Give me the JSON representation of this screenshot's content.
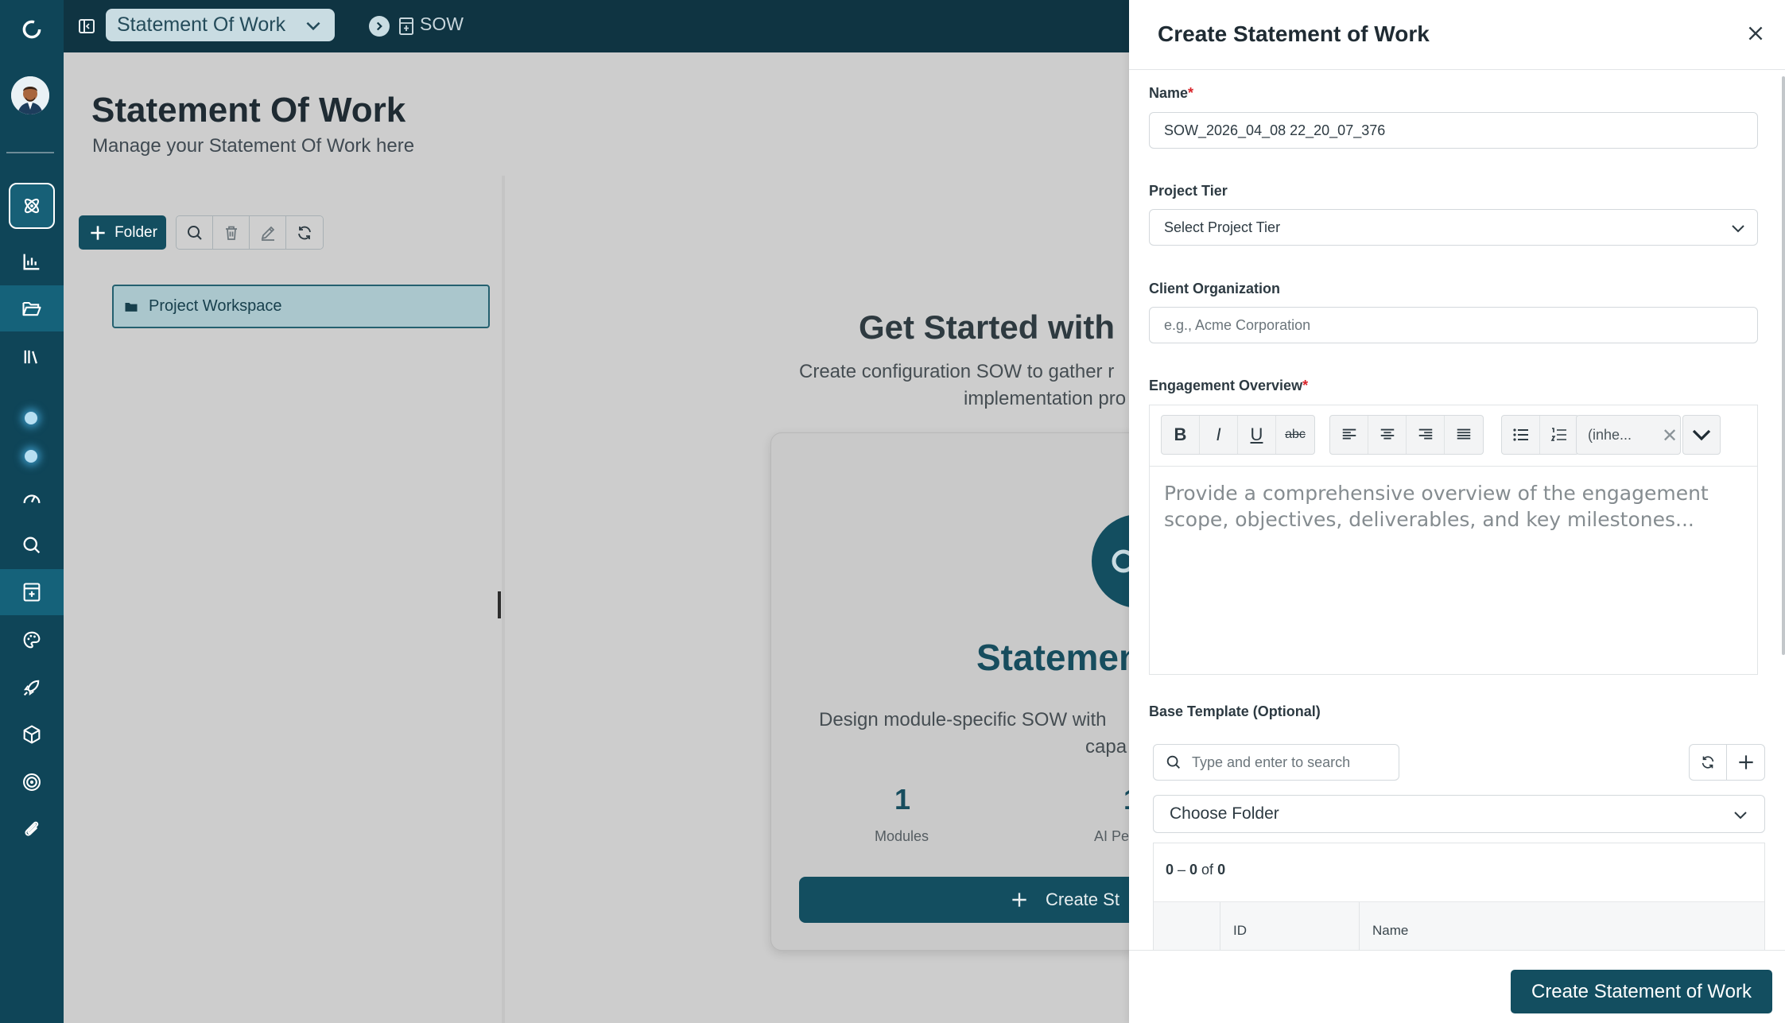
{
  "app": {
    "workspace_selector": "Statement Of Work",
    "breadcrumb_label": "SOW"
  },
  "sidebar": {
    "items": [
      {
        "icon": "logo-icon"
      },
      {
        "icon": "avatar"
      },
      {
        "icon": "atom-icon"
      },
      {
        "icon": "bar-chart-icon"
      },
      {
        "icon": "folder-open-icon"
      },
      {
        "icon": "library-icon"
      },
      {
        "icon": "status-dot"
      },
      {
        "icon": "status-dot"
      },
      {
        "icon": "gauge-icon"
      },
      {
        "icon": "search-icon"
      },
      {
        "icon": "calculator-doc-icon"
      },
      {
        "icon": "palette-icon"
      },
      {
        "icon": "rocket-icon"
      },
      {
        "icon": "cube-icon"
      },
      {
        "icon": "target-icon"
      },
      {
        "icon": "paperclip-icon"
      }
    ]
  },
  "page": {
    "title": "Statement Of Work",
    "subtitle": "Manage your Statement Of Work here",
    "folder_button": "Folder",
    "tree_item": "Project Workspace"
  },
  "empty_state": {
    "title": "Get Started with",
    "sub_line1": "Create configuration SOW to gather r",
    "sub_line2": "implementation pro",
    "card_title": "Statemen",
    "card_desc1": "Design module-specific SOW with",
    "card_desc2": "capa",
    "stat1_value": "1",
    "stat1_label": "Modules",
    "stat2_value": "1",
    "stat2_label": "AI Pe",
    "cta": "Create St"
  },
  "panel": {
    "title": "Create Statement of Work",
    "name_label": "Name",
    "name_value": "SOW_2026_04_08 22_20_07_376",
    "tier_label": "Project Tier",
    "tier_placeholder": "Select Project Tier",
    "client_label": "Client Organization",
    "client_placeholder": "e.g., Acme Corporation",
    "overview_label": "Engagement Overview",
    "overview_placeholder": "Provide a comprehensive overview of the engagement scope, objectives, deliverables, and key milestones...",
    "toolbar": {
      "bold": "B",
      "italic": "I",
      "underline": "U",
      "strike": "abc",
      "font_select": "(inhe..."
    },
    "template_label": "Base Template (Optional)",
    "search_placeholder": "Type and enter to search",
    "folder_select": "Choose Folder",
    "pager_from": "0",
    "pager_to": "0",
    "pager_total": "0",
    "columns": [
      "ID",
      "Name"
    ],
    "submit": "Create Statement of Work"
  },
  "colors": {
    "sidebar": "#0f4558",
    "topbar": "#0f3442",
    "primary": "#134e60",
    "required": "#d9252b"
  }
}
